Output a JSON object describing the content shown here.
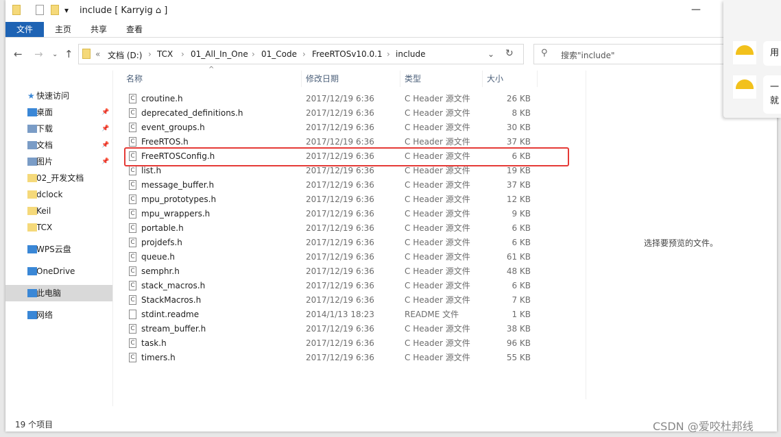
{
  "window": {
    "title": "include [ Karryig ⌂ ]",
    "minimize": "—"
  },
  "ribbon": {
    "tabs": [
      "文件",
      "主页",
      "共享",
      "查看"
    ]
  },
  "address": {
    "path": [
      "文档 (D:)",
      "TCX",
      "01_All_In_One",
      "01_Code",
      "FreeRTOSv10.0.1",
      "include"
    ],
    "overflow": "«"
  },
  "search": {
    "placeholder": "搜索\"include\""
  },
  "sidebar": {
    "items": [
      {
        "label": "快速访问",
        "icon": "star-icon"
      },
      {
        "label": "桌面",
        "icon": "desktop-icon",
        "pinned": true
      },
      {
        "label": "下载",
        "icon": "download-icon",
        "pinned": true
      },
      {
        "label": "文档",
        "icon": "document-icon",
        "pinned": true
      },
      {
        "label": "图片",
        "icon": "pictures-icon",
        "pinned": true
      },
      {
        "label": "02_开发文档",
        "icon": "folder-icon"
      },
      {
        "label": "dclock",
        "icon": "folder-icon"
      },
      {
        "label": "Keil",
        "icon": "folder-icon"
      },
      {
        "label": "TCX",
        "icon": "folder-icon"
      },
      {
        "label": "WPS云盘",
        "icon": "cloud-icon"
      },
      {
        "label": "OneDrive",
        "icon": "cloud-icon"
      },
      {
        "label": "此电脑",
        "icon": "computer-icon",
        "selected": true
      },
      {
        "label": "网络",
        "icon": "network-icon"
      }
    ]
  },
  "columns": [
    "名称",
    "修改日期",
    "类型",
    "大小"
  ],
  "files": [
    [
      "croutine.h",
      "2017/12/19 6:36",
      "C Header 源文件",
      "26 KB"
    ],
    [
      "deprecated_definitions.h",
      "2017/12/19 6:36",
      "C Header 源文件",
      "8 KB"
    ],
    [
      "event_groups.h",
      "2017/12/19 6:36",
      "C Header 源文件",
      "30 KB"
    ],
    [
      "FreeRTOS.h",
      "2017/12/19 6:36",
      "C Header 源文件",
      "37 KB"
    ],
    [
      "FreeRTOSConfig.h",
      "2017/12/19 6:36",
      "C Header 源文件",
      "6 KB"
    ],
    [
      "list.h",
      "2017/12/19 6:36",
      "C Header 源文件",
      "19 KB"
    ],
    [
      "message_buffer.h",
      "2017/12/19 6:36",
      "C Header 源文件",
      "37 KB"
    ],
    [
      "mpu_prototypes.h",
      "2017/12/19 6:36",
      "C Header 源文件",
      "12 KB"
    ],
    [
      "mpu_wrappers.h",
      "2017/12/19 6:36",
      "C Header 源文件",
      "9 KB"
    ],
    [
      "portable.h",
      "2017/12/19 6:36",
      "C Header 源文件",
      "6 KB"
    ],
    [
      "projdefs.h",
      "2017/12/19 6:36",
      "C Header 源文件",
      "6 KB"
    ],
    [
      "queue.h",
      "2017/12/19 6:36",
      "C Header 源文件",
      "61 KB"
    ],
    [
      "semphr.h",
      "2017/12/19 6:36",
      "C Header 源文件",
      "48 KB"
    ],
    [
      "stack_macros.h",
      "2017/12/19 6:36",
      "C Header 源文件",
      "6 KB"
    ],
    [
      "StackMacros.h",
      "2017/12/19 6:36",
      "C Header 源文件",
      "7 KB"
    ],
    [
      "stdint.readme",
      "2014/1/13 18:23",
      "README 文件",
      "1 KB"
    ],
    [
      "stream_buffer.h",
      "2017/12/19 6:36",
      "C Header 源文件",
      "38 KB"
    ],
    [
      "task.h",
      "2017/12/19 6:36",
      "C Header 源文件",
      "96 KB"
    ],
    [
      "timers.h",
      "2017/12/19 6:36",
      "C Header 源文件",
      "55 KB"
    ]
  ],
  "highlighted_file": "FreeRTOSConfig.h",
  "preview": {
    "text": "选择要预览的文件。"
  },
  "status": {
    "count": "19 个项目"
  },
  "watermark": "CSDN @爱咬杜邦线",
  "notifications": [
    {
      "text": "用"
    },
    {
      "text": "一 就"
    }
  ],
  "colors": {
    "accent": "#1e63b4",
    "highlight": "#e53935",
    "selected": "#d9d9d9"
  }
}
